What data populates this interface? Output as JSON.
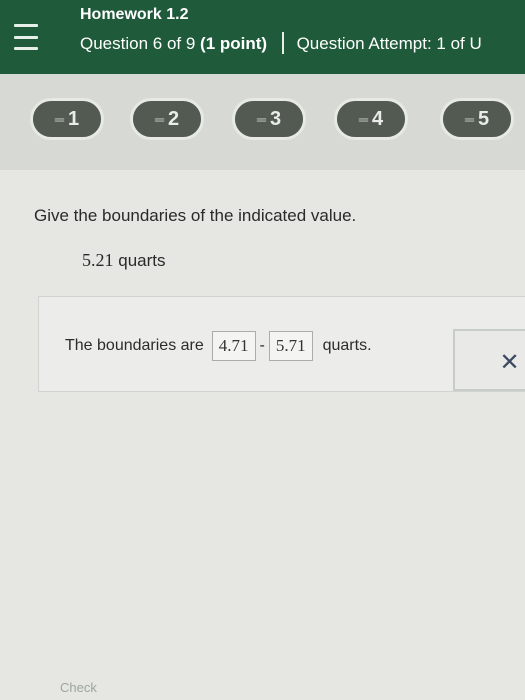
{
  "header": {
    "homework_title": "Homework 1.2",
    "question_text": "Question 6 of 9",
    "points": "(1 point)",
    "attempt_text": "Question Attempt: 1 of U"
  },
  "nav": {
    "items": [
      {
        "label": "1"
      },
      {
        "label": "2"
      },
      {
        "label": "3"
      },
      {
        "label": "4"
      },
      {
        "label": "5"
      }
    ],
    "item_icon": "equals-icon"
  },
  "question": {
    "prompt": "Give the boundaries of the indicated value.",
    "value": "5.21",
    "unit": "quarts"
  },
  "answer": {
    "lead": "The boundaries are",
    "lower": "4.71",
    "separator": "-",
    "upper": "5.71",
    "unit": "quarts.",
    "clear_icon": "close-icon",
    "clear_glyph": "✕"
  },
  "footer": {
    "check_label": "Check"
  },
  "colors": {
    "header_bg": "#1f5a3a",
    "pill_bg": "#525a52",
    "accent_x": "#3c4b63"
  }
}
